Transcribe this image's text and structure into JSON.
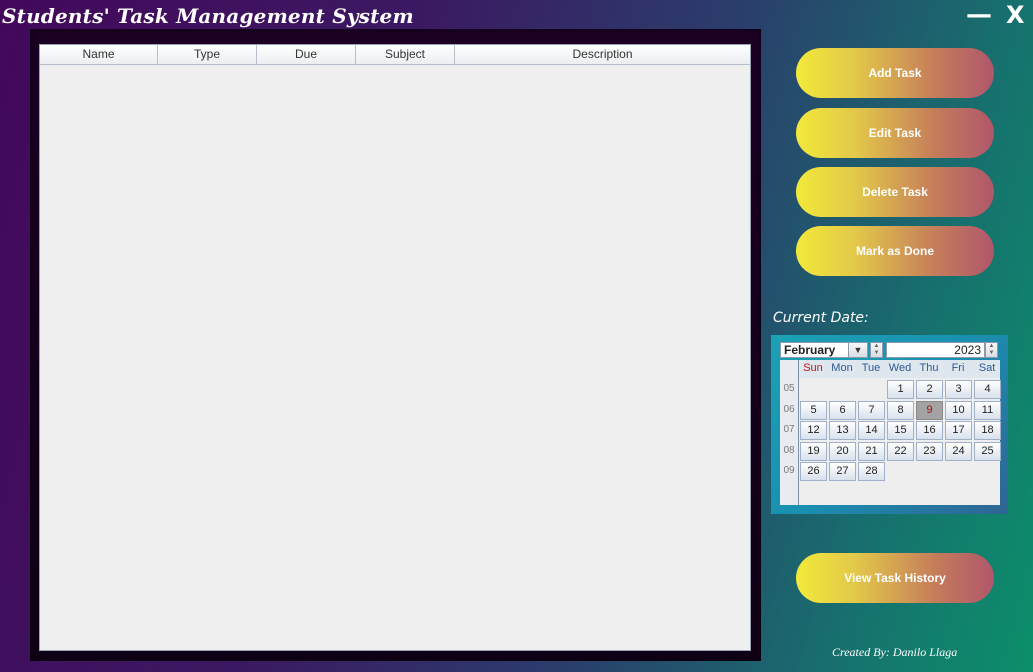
{
  "app": {
    "title": "Students' Task Management System"
  },
  "window_controls": {
    "minimize_label": "—",
    "close_label": "X"
  },
  "table": {
    "columns": [
      "Name",
      "Type",
      "Due",
      "Subject",
      "Description"
    ],
    "rows": []
  },
  "actions": {
    "add": "Add Task",
    "edit": "Edit Task",
    "delete": "Delete Task",
    "mark_done": "Mark as Done",
    "history": "View Task History"
  },
  "calendar": {
    "label": "Current Date:",
    "month": "February",
    "year": "2023",
    "selected_day": "9",
    "weekdays": [
      "Sun",
      "Mon",
      "Tue",
      "Wed",
      "Thu",
      "Fri",
      "Sat"
    ],
    "weeks": [
      {
        "num": "05",
        "days": [
          "",
          "",
          "",
          "1",
          "2",
          "3",
          "4"
        ]
      },
      {
        "num": "06",
        "days": [
          "5",
          "6",
          "7",
          "8",
          "9",
          "10",
          "11"
        ]
      },
      {
        "num": "07",
        "days": [
          "12",
          "13",
          "14",
          "15",
          "16",
          "17",
          "18"
        ]
      },
      {
        "num": "08",
        "days": [
          "19",
          "20",
          "21",
          "22",
          "23",
          "24",
          "25"
        ]
      },
      {
        "num": "09",
        "days": [
          "26",
          "27",
          "28",
          "",
          "",
          "",
          ""
        ]
      }
    ]
  },
  "footer": {
    "credit": "Created By: Danilo Llaga"
  }
}
